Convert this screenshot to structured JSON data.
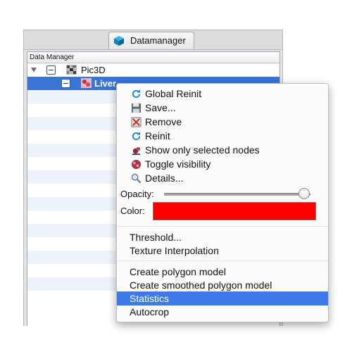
{
  "tab": {
    "label": "Datamanager"
  },
  "tree": {
    "header": "Data Manager",
    "nodes": [
      {
        "label": "Pic3D"
      },
      {
        "label": "Liver"
      }
    ]
  },
  "menu": {
    "items": [
      {
        "label": "Global Reinit",
        "icon": "refresh-icon"
      },
      {
        "label": "Save...",
        "icon": "floppy-disk-icon"
      },
      {
        "label": "Remove",
        "icon": "remove-icon"
      },
      {
        "label": "Reinit",
        "icon": "refresh-icon"
      },
      {
        "label": "Show only selected nodes",
        "icon": "selected-nodes-icon"
      },
      {
        "label": "Toggle visibility",
        "icon": "visibility-icon"
      },
      {
        "label": "Details...",
        "icon": "magnifier-icon"
      }
    ],
    "opacity_label": "Opacity:",
    "opacity_value": 1.0,
    "color_label": "Color:",
    "color_value": "#ff0000",
    "group2": [
      "Threshold...",
      "Texture Interpolation"
    ],
    "group3": [
      "Create polygon model",
      "Create smoothed polygon model",
      "Statistics",
      "Autocrop"
    ],
    "highlighted": "Statistics"
  },
  "colors": {
    "selection": "#3875d7",
    "menu_highlight": "#3b7ae8"
  }
}
